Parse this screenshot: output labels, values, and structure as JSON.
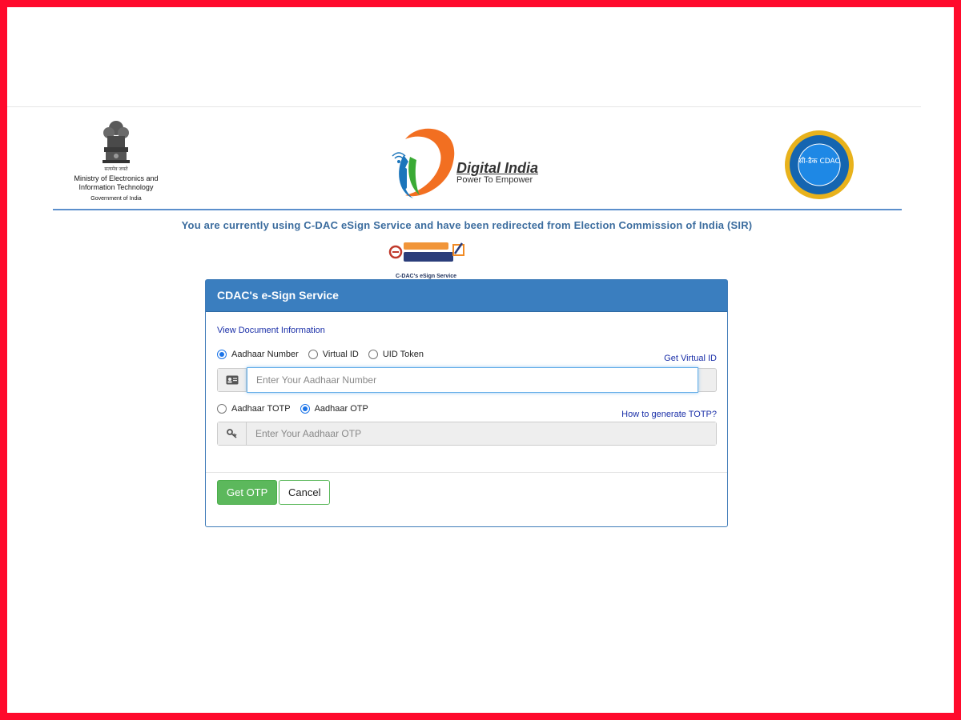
{
  "header": {
    "emblem_hindi": "सत्यमेव जयते",
    "ministry": "Ministry of Electronics and Information Technology",
    "government": "Government of India",
    "digital_india_title": "Digital India",
    "digital_india_tagline": "Power To Empower",
    "cdac_seal_text": "सी-डैक CDAC"
  },
  "redirect_message": "You are currently using C-DAC eSign Service and have been redirected from Election Commission of India (SIR)",
  "hastakshar": {
    "caption": "C-DAC's eSign Service"
  },
  "panel": {
    "title": "CDAC's e-Sign Service",
    "view_document": "View Document Information",
    "id_options": [
      {
        "label": "Aadhaar Number",
        "checked": true
      },
      {
        "label": "Virtual ID",
        "checked": false
      },
      {
        "label": "UID Token",
        "checked": false
      }
    ],
    "get_virtual_id": "Get Virtual ID",
    "aadhaar_placeholder": "Enter Your Aadhaar Number",
    "otp_options": [
      {
        "label": "Aadhaar TOTP",
        "checked": false
      },
      {
        "label": "Aadhaar OTP",
        "checked": true
      }
    ],
    "totp_help": "How to generate TOTP?",
    "otp_placeholder": "Enter Your Aadhaar OTP",
    "get_otp_label": "Get OTP",
    "cancel_label": "Cancel"
  },
  "colors": {
    "frame": "#ff0a2c",
    "panel_header": "#3a7ebf",
    "link": "#1a2fa8",
    "button_green": "#5cb85c"
  },
  "icons": {
    "emblem": "national-emblem-icon",
    "id_card": "id-card-icon",
    "key": "key-icon"
  }
}
